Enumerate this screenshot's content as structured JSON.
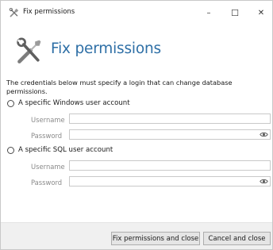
{
  "window": {
    "title": "Fix permissions",
    "minimize_glyph": "–",
    "maximize_glyph": "☐",
    "close_glyph": "✕",
    "icon": "tools-icon"
  },
  "header": {
    "title": "Fix permissions",
    "icon": "tools-icon",
    "accent_color": "#2e6fa6"
  },
  "description": "The credentials below must specify a login that can change database permissions.",
  "options": [
    {
      "label": "A specific Windows user account",
      "selected": false,
      "fields": {
        "username_label": "Username",
        "username_value": "",
        "password_label": "Password",
        "password_value": ""
      }
    },
    {
      "label": "A specific SQL user account",
      "selected": false,
      "fields": {
        "username_label": "Username",
        "username_value": "",
        "password_label": "Password",
        "password_value": ""
      }
    }
  ],
  "buttons": {
    "fix_label": "Fix permissions and close",
    "cancel_label": "Cancel and close"
  }
}
